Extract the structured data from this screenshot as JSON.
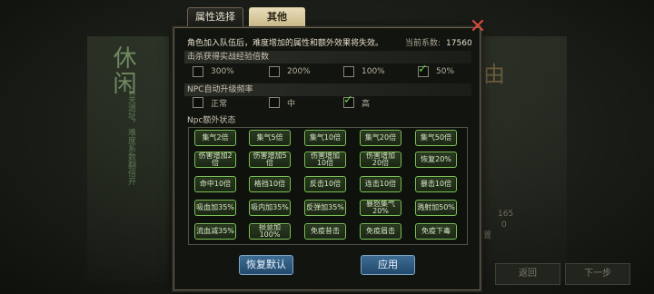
{
  "background": {
    "left_title": "休闲",
    "left_text": "日关遗址，难度系数翻倍开",
    "right_char": "由",
    "right_stats": [
      "165",
      "0",
      "置"
    ],
    "back_label": "返回",
    "next_label": "下一步"
  },
  "tabs": {
    "attr": "属性选择",
    "other": "其他"
  },
  "notice": "角色加入队伍后，难度增加的属性和额外效果将失效。",
  "coef": {
    "label": "当前系数:",
    "value": "17560"
  },
  "exp": {
    "title": "击杀获得实战经验倍数",
    "options": [
      {
        "label": "300%",
        "checked": false
      },
      {
        "label": "200%",
        "checked": false
      },
      {
        "label": "100%",
        "checked": false
      },
      {
        "label": "50%",
        "checked": true
      }
    ]
  },
  "npc_level": {
    "title": "NPC自动升级频率",
    "options": [
      {
        "label": "正常",
        "checked": false
      },
      {
        "label": "中",
        "checked": false
      },
      {
        "label": "高",
        "checked": true
      }
    ]
  },
  "npc_status": {
    "title": "Npc额外状态",
    "buttons": [
      "集气2倍",
      "集气5倍",
      "集气10倍",
      "集气20倍",
      "集气50倍",
      "伤害增加2倍",
      "伤害增加5倍",
      "伤害增加\n10倍",
      "伤害增加\n20倍",
      "恢复20%",
      "命中10倍",
      "格挡10倍",
      "反击10倍",
      "连击10倍",
      "暴击10倍",
      "吸血加35%",
      "吸内加35%",
      "反弹加35%",
      "暴怒集气20%",
      "溅射加50%",
      "流血减35%",
      "损意加100%",
      "免疫昔击",
      "免疫眉击",
      "免疫下毒"
    ]
  },
  "actions": {
    "reset": "恢复默认",
    "apply": "应用"
  },
  "colors": {
    "check": "#63d04a",
    "button_border": "#7dc05a",
    "primary": "#2f5c82"
  }
}
